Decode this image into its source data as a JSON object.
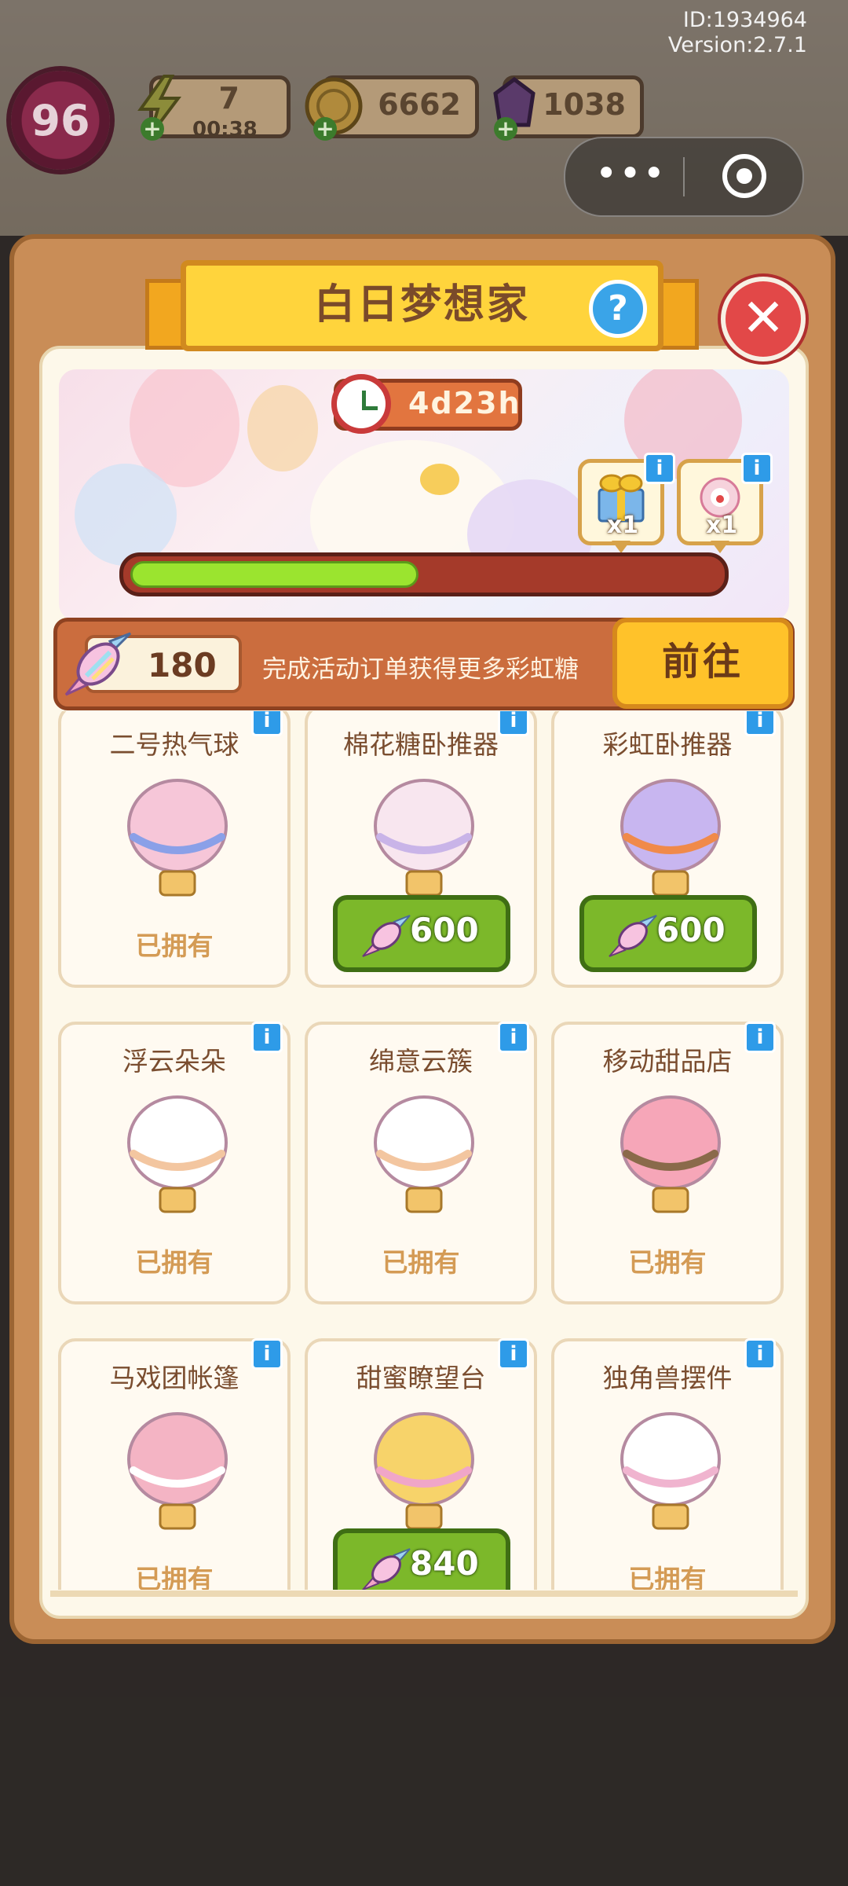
{
  "build": {
    "id": "ID:1934964",
    "version": "Version:2.7.1"
  },
  "hud": {
    "level": "96",
    "energy": {
      "value": "7",
      "timer": "00:38"
    },
    "coins": "6662",
    "gems": "1038"
  },
  "panel": {
    "title": "白日梦想家",
    "help_symbol": "?",
    "close_symbol": "✕"
  },
  "event": {
    "timer": "4d23h",
    "progress_fraction": 0.49,
    "rewards": [
      {
        "icon": "gift-box-icon",
        "count": "x1"
      },
      {
        "icon": "clown-decoration-icon",
        "count": "x1"
      }
    ]
  },
  "currency": {
    "candies": "180",
    "hint": "完成活动订单获得更多彩虹糖",
    "goto_label": "前往"
  },
  "shop_items": [
    {
      "name": "二号热气球",
      "icon": "hot-air-balloon-icon",
      "owned": true,
      "status": "已拥有"
    },
    {
      "name": "棉花糖卧推器",
      "icon": "marshmallow-bench-icon",
      "owned": false,
      "price": "600"
    },
    {
      "name": "彩虹卧推器",
      "icon": "rainbow-bench-icon",
      "owned": false,
      "price": "600"
    },
    {
      "name": "浮云朵朵",
      "icon": "cloud-fence-icon",
      "owned": true,
      "status": "已拥有"
    },
    {
      "name": "绵意云簇",
      "icon": "cloud-cluster-icon",
      "owned": true,
      "status": "已拥有"
    },
    {
      "name": "移动甜品店",
      "icon": "dessert-cart-icon",
      "owned": true,
      "status": "已拥有"
    },
    {
      "name": "马戏团帐篷",
      "icon": "circus-tent-icon",
      "owned": true,
      "status": "已拥有"
    },
    {
      "name": "甜蜜瞭望台",
      "icon": "watchtower-icon",
      "owned": false,
      "price": "840"
    },
    {
      "name": "独角兽摆件",
      "icon": "unicorn-ornament-icon",
      "owned": true,
      "status": "已拥有"
    }
  ],
  "colors": {
    "panel": "#c98d57",
    "title_ribbon": "#ffd43c",
    "buy_button": "#7cb82a",
    "info_badge": "#2e9be8",
    "close_button": "#e24848"
  }
}
